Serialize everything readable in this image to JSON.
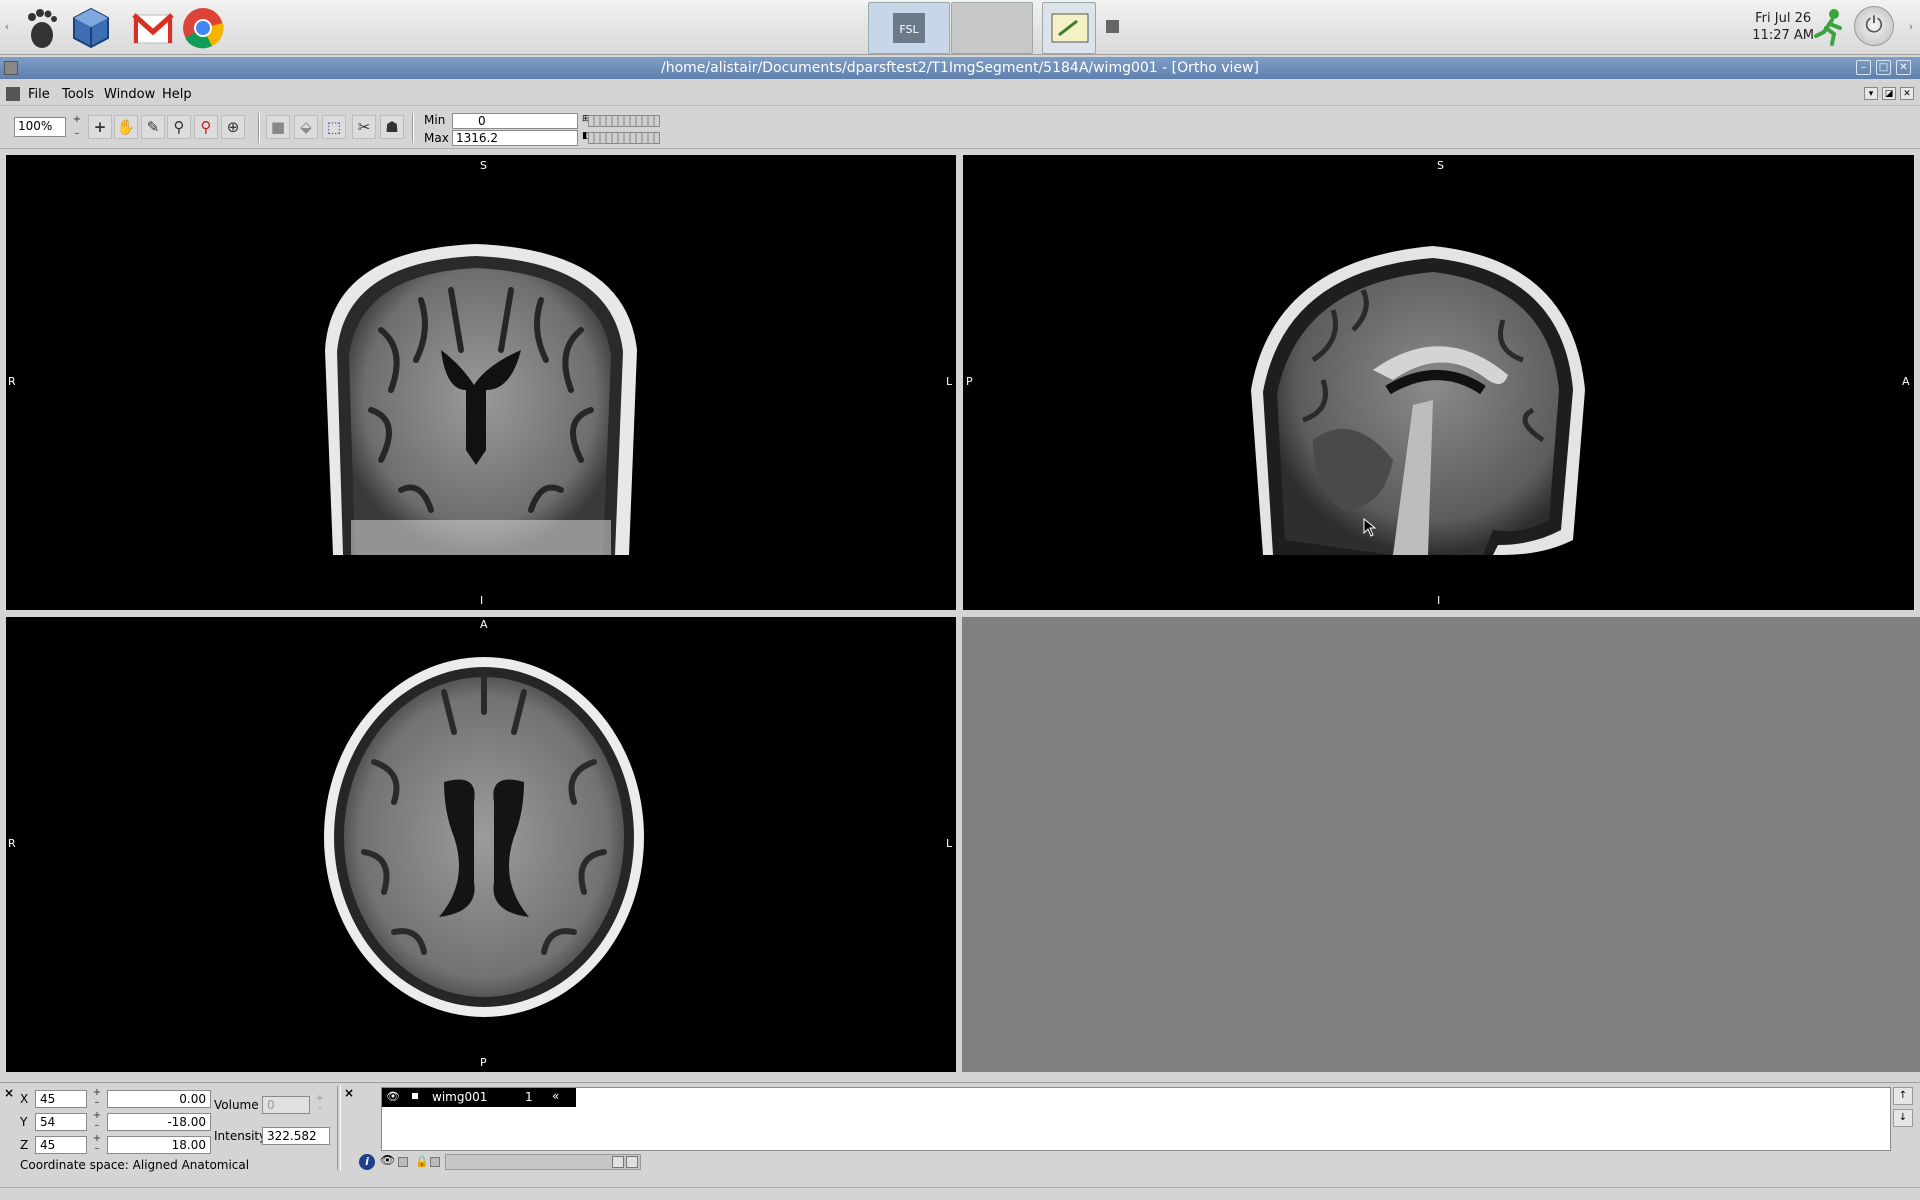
{
  "taskbar": {
    "clock_day": "Fri Jul 26",
    "clock_time": "11:27 AM",
    "launchers": [
      "gnome-foot-icon",
      "virtualbox-icon",
      "gmail-icon",
      "chrome-icon"
    ]
  },
  "window": {
    "title": "/home/alistair/Documents/dparsftest2/T1ImgSegment/5184A/wimg001 - [Ortho view]"
  },
  "menu": {
    "file": "File",
    "tools": "Tools",
    "window": "Window",
    "help": "Help"
  },
  "toolbar": {
    "zoom": "100%",
    "min_label": "Min",
    "min_value": "0",
    "max_label": "Max",
    "max_value": "1316.2"
  },
  "views": {
    "coronal": {
      "top": "S",
      "bottom": "I",
      "left": "R",
      "right": "L"
    },
    "sagittal": {
      "top": "S",
      "bottom": "I",
      "left": "P",
      "right": "A"
    },
    "axial": {
      "top": "A",
      "bottom": "P",
      "left": "R",
      "right": "L"
    }
  },
  "cursor": {
    "x_label": "X",
    "x_voxel": "45",
    "x_world": "0.00",
    "y_label": "Y",
    "y_voxel": "54",
    "y_world": "-18.00",
    "z_label": "Z",
    "z_voxel": "45",
    "z_world": "18.00",
    "volume_label": "Volume",
    "volume_value": "0",
    "intensity_label": "Intensity",
    "intensity_value": "322.582",
    "coordinate_space": "Coordinate space: Aligned Anatomical"
  },
  "layers": {
    "items": [
      {
        "name": "wimg001",
        "index": "1"
      }
    ]
  }
}
